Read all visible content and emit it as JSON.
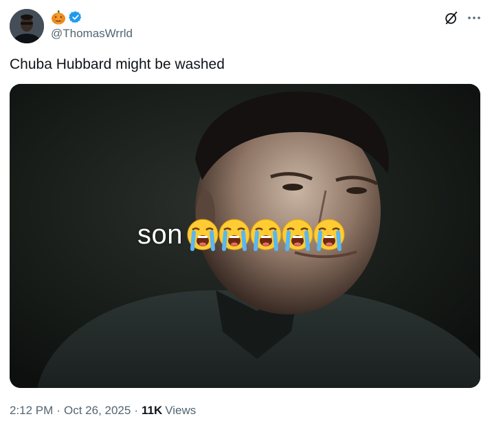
{
  "user": {
    "handle": "@ThomasWrrld",
    "avatar": "avatar-photo",
    "badge_icon": "pumpkin-emoji-icon",
    "verified_icon": "verified-badge-icon",
    "verified_color": "#1d9bf0"
  },
  "header_icons": {
    "grok": "grok-icon",
    "more": "more-icon"
  },
  "tweet": {
    "text": "Chuba Hubbard might be washed"
  },
  "media": {
    "caption_word": "son",
    "caption_emoji_count": 5,
    "caption_emoji": "loudly-crying-face-icon"
  },
  "meta": {
    "time": "2:12 PM",
    "separator": "·",
    "date": "Oct 26, 2025",
    "views_count": "11K",
    "views_label": "Views"
  },
  "colors": {
    "text_primary": "#0f1419",
    "text_secondary": "#536471",
    "accent": "#1d9bf0"
  }
}
